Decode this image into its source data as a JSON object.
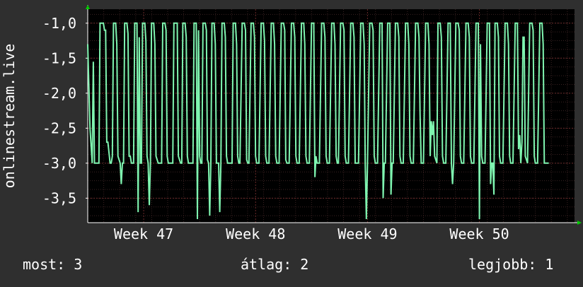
{
  "chart_data": {
    "type": "line",
    "ylabel": "onlinestream.live",
    "ylim": [
      -3.85,
      -0.8
    ],
    "yticks": [
      {
        "value": -1.0,
        "label": "-1,0"
      },
      {
        "value": -1.5,
        "label": "-1,5"
      },
      {
        "value": -2.0,
        "label": "-2,0"
      },
      {
        "value": -2.5,
        "label": "-2,5"
      },
      {
        "value": -3.0,
        "label": "-3,0"
      },
      {
        "value": -3.5,
        "label": "-3,5"
      }
    ],
    "xticks": [
      {
        "value": 1,
        "label": "Week 47"
      },
      {
        "value": 2,
        "label": "Week 48"
      },
      {
        "value": 3,
        "label": "Week 49"
      },
      {
        "value": 4,
        "label": "Week 50"
      }
    ],
    "xlim": [
      0.5,
      4.85
    ],
    "grid": true,
    "series": [
      {
        "color": "#7ff5b0",
        "points": [
          [
            0.5,
            -1.3
          ],
          [
            0.52,
            -2.5
          ],
          [
            0.54,
            -3.0
          ],
          [
            0.55,
            -1.55
          ],
          [
            0.56,
            -3.0
          ],
          [
            0.58,
            -3.0
          ],
          [
            0.6,
            -3.0
          ],
          [
            0.61,
            -1.0
          ],
          [
            0.63,
            -1.0
          ],
          [
            0.64,
            -1.0
          ],
          [
            0.65,
            -1.1
          ],
          [
            0.66,
            -1.1
          ],
          [
            0.67,
            -2.7
          ],
          [
            0.68,
            -2.7
          ],
          [
            0.7,
            -3.0
          ],
          [
            0.71,
            -3.0
          ],
          [
            0.72,
            -2.9
          ],
          [
            0.73,
            -1.0
          ],
          [
            0.75,
            -1.0
          ],
          [
            0.76,
            -1.3
          ],
          [
            0.77,
            -2.9
          ],
          [
            0.79,
            -3.0
          ],
          [
            0.8,
            -3.3
          ],
          [
            0.81,
            -3.0
          ],
          [
            0.82,
            -3.0
          ],
          [
            0.83,
            -1.0
          ],
          [
            0.85,
            -1.0
          ],
          [
            0.86,
            -1.15
          ],
          [
            0.87,
            -2.9
          ],
          [
            0.88,
            -2.9
          ],
          [
            0.89,
            -3.0
          ],
          [
            0.9,
            -3.0
          ],
          [
            0.91,
            -3.0
          ],
          [
            0.92,
            -1.0
          ],
          [
            0.94,
            -1.0
          ],
          [
            0.95,
            -3.7
          ],
          [
            0.96,
            -1.2
          ],
          [
            0.97,
            -3.0
          ],
          [
            0.98,
            -3.0
          ],
          [
            0.99,
            -1.0
          ],
          [
            1.01,
            -1.0
          ],
          [
            1.02,
            -1.25
          ],
          [
            1.03,
            -2.9
          ],
          [
            1.04,
            -3.0
          ],
          [
            1.05,
            -3.6
          ],
          [
            1.06,
            -3.0
          ],
          [
            1.07,
            -1.0
          ],
          [
            1.09,
            -1.0
          ],
          [
            1.1,
            -1.3
          ],
          [
            1.11,
            -2.9
          ],
          [
            1.12,
            -2.95
          ],
          [
            1.13,
            -3.0
          ],
          [
            1.15,
            -3.0
          ],
          [
            1.16,
            -3.0
          ],
          [
            1.17,
            -1.0
          ],
          [
            1.19,
            -1.0
          ],
          [
            1.2,
            -1.1
          ],
          [
            1.21,
            -2.9
          ],
          [
            1.22,
            -3.0
          ],
          [
            1.24,
            -3.0
          ],
          [
            1.26,
            -3.0
          ],
          [
            1.27,
            -1.0
          ],
          [
            1.29,
            -1.0
          ],
          [
            1.3,
            -1.0
          ],
          [
            1.31,
            -2.9
          ],
          [
            1.32,
            -2.95
          ],
          [
            1.33,
            -3.0
          ],
          [
            1.34,
            -3.0
          ],
          [
            1.35,
            -1.0
          ],
          [
            1.37,
            -1.0
          ],
          [
            1.38,
            -1.2
          ],
          [
            1.39,
            -2.9
          ],
          [
            1.4,
            -3.0
          ],
          [
            1.42,
            -3.0
          ],
          [
            1.44,
            -3.0
          ],
          [
            1.45,
            -1.0
          ],
          [
            1.47,
            -1.0
          ],
          [
            1.48,
            -3.8
          ],
          [
            1.49,
            -1.1
          ],
          [
            1.5,
            -2.9
          ],
          [
            1.51,
            -3.0
          ],
          [
            1.52,
            -3.0
          ],
          [
            1.53,
            -1.0
          ],
          [
            1.55,
            -1.0
          ],
          [
            1.56,
            -1.1
          ],
          [
            1.57,
            -2.95
          ],
          [
            1.58,
            -3.0
          ],
          [
            1.59,
            -3.75
          ],
          [
            1.6,
            -3.0
          ],
          [
            1.61,
            -1.0
          ],
          [
            1.63,
            -1.0
          ],
          [
            1.64,
            -1.3
          ],
          [
            1.65,
            -3.0
          ],
          [
            1.66,
            -3.0
          ],
          [
            1.67,
            -3.0
          ],
          [
            1.68,
            -3.7
          ],
          [
            1.69,
            -3.0
          ],
          [
            1.7,
            -1.0
          ],
          [
            1.72,
            -1.0
          ],
          [
            1.73,
            -1.2
          ],
          [
            1.74,
            -2.9
          ],
          [
            1.75,
            -3.0
          ],
          [
            1.77,
            -3.0
          ],
          [
            1.79,
            -3.0
          ],
          [
            1.8,
            -1.0
          ],
          [
            1.82,
            -1.0
          ],
          [
            1.83,
            -1.3
          ],
          [
            1.84,
            -2.9
          ],
          [
            1.85,
            -3.0
          ],
          [
            1.86,
            -3.0
          ],
          [
            1.88,
            -1.0
          ],
          [
            1.9,
            -1.0
          ],
          [
            1.91,
            -1.1
          ],
          [
            1.92,
            -2.95
          ],
          [
            1.93,
            -3.0
          ],
          [
            1.94,
            -3.0
          ],
          [
            1.96,
            -1.0
          ],
          [
            1.98,
            -1.0
          ],
          [
            1.99,
            -1.2
          ],
          [
            2.0,
            -2.9
          ],
          [
            2.01,
            -3.0
          ],
          [
            2.03,
            -3.0
          ],
          [
            2.05,
            -1.0
          ],
          [
            2.07,
            -1.0
          ],
          [
            2.08,
            -1.25
          ],
          [
            2.09,
            -2.9
          ],
          [
            2.1,
            -3.0
          ],
          [
            2.12,
            -3.0
          ],
          [
            2.14,
            -1.0
          ],
          [
            2.16,
            -1.0
          ],
          [
            2.17,
            -1.3
          ],
          [
            2.18,
            -2.9
          ],
          [
            2.19,
            -3.0
          ],
          [
            2.21,
            -3.0
          ],
          [
            2.23,
            -1.0
          ],
          [
            2.25,
            -1.0
          ],
          [
            2.26,
            -1.1
          ],
          [
            2.27,
            -2.95
          ],
          [
            2.28,
            -3.0
          ],
          [
            2.3,
            -3.0
          ],
          [
            2.32,
            -1.0
          ],
          [
            2.34,
            -1.0
          ],
          [
            2.35,
            -1.2
          ],
          [
            2.36,
            -2.9
          ],
          [
            2.37,
            -3.0
          ],
          [
            2.39,
            -3.0
          ],
          [
            2.41,
            -1.0
          ],
          [
            2.43,
            -1.0
          ],
          [
            2.44,
            -1.3
          ],
          [
            2.45,
            -2.9
          ],
          [
            2.46,
            -3.0
          ],
          [
            2.48,
            -3.0
          ],
          [
            2.5,
            -1.0
          ],
          [
            2.52,
            -1.0
          ],
          [
            2.53,
            -3.2
          ],
          [
            2.54,
            -2.9
          ],
          [
            2.55,
            -3.0
          ],
          [
            2.57,
            -3.0
          ],
          [
            2.59,
            -1.0
          ],
          [
            2.61,
            -1.0
          ],
          [
            2.62,
            -1.2
          ],
          [
            2.63,
            -2.9
          ],
          [
            2.64,
            -3.0
          ],
          [
            2.66,
            -3.0
          ],
          [
            2.68,
            -1.0
          ],
          [
            2.7,
            -1.0
          ],
          [
            2.71,
            -1.3
          ],
          [
            2.72,
            -2.9
          ],
          [
            2.73,
            -3.0
          ],
          [
            2.74,
            -3.0
          ],
          [
            2.76,
            -1.0
          ],
          [
            2.78,
            -1.0
          ],
          [
            2.79,
            -1.1
          ],
          [
            2.8,
            -2.9
          ],
          [
            2.81,
            -3.0
          ],
          [
            2.83,
            -3.0
          ],
          [
            2.85,
            -1.0
          ],
          [
            2.87,
            -1.0
          ],
          [
            2.88,
            -1.2
          ],
          [
            2.89,
            -3.0
          ],
          [
            2.9,
            -3.0
          ],
          [
            2.92,
            -3.0
          ],
          [
            2.94,
            -1.0
          ],
          [
            2.96,
            -1.0
          ],
          [
            2.97,
            -1.3
          ],
          [
            2.98,
            -3.0
          ],
          [
            2.99,
            -3.8
          ],
          [
            3.0,
            -3.0
          ],
          [
            3.02,
            -1.0
          ],
          [
            3.04,
            -1.0
          ],
          [
            3.05,
            -1.1
          ],
          [
            3.06,
            -2.9
          ],
          [
            3.07,
            -3.0
          ],
          [
            3.09,
            -3.0
          ],
          [
            3.11,
            -1.0
          ],
          [
            3.13,
            -1.0
          ],
          [
            3.14,
            -3.5
          ],
          [
            3.15,
            -3.0
          ],
          [
            3.16,
            -3.0
          ],
          [
            3.18,
            -1.0
          ],
          [
            3.2,
            -1.0
          ],
          [
            3.21,
            -3.45
          ],
          [
            3.22,
            -3.0
          ],
          [
            3.23,
            -3.0
          ],
          [
            3.25,
            -1.0
          ],
          [
            3.27,
            -1.0
          ],
          [
            3.28,
            -1.2
          ],
          [
            3.29,
            -2.9
          ],
          [
            3.3,
            -3.0
          ],
          [
            3.32,
            -3.0
          ],
          [
            3.34,
            -1.0
          ],
          [
            3.36,
            -1.0
          ],
          [
            3.37,
            -1.3
          ],
          [
            3.38,
            -2.9
          ],
          [
            3.39,
            -3.0
          ],
          [
            3.41,
            -3.0
          ],
          [
            3.43,
            -1.0
          ],
          [
            3.45,
            -1.0
          ],
          [
            3.46,
            -1.2
          ],
          [
            3.47,
            -2.3
          ],
          [
            3.48,
            -3.0
          ],
          [
            3.5,
            -3.0
          ],
          [
            3.52,
            -1.0
          ],
          [
            3.54,
            -1.0
          ],
          [
            3.55,
            -1.3
          ],
          [
            3.56,
            -2.9
          ],
          [
            3.57,
            -2.4
          ],
          [
            3.58,
            -2.6
          ],
          [
            3.59,
            -2.4
          ],
          [
            3.6,
            -2.9
          ],
          [
            3.62,
            -3.0
          ],
          [
            3.63,
            -1.0
          ],
          [
            3.65,
            -1.0
          ],
          [
            3.66,
            -1.2
          ],
          [
            3.67,
            -2.9
          ],
          [
            3.68,
            -3.0
          ],
          [
            3.7,
            -3.0
          ],
          [
            3.72,
            -1.0
          ],
          [
            3.74,
            -1.0
          ],
          [
            3.75,
            -3.0
          ],
          [
            3.76,
            -3.3
          ],
          [
            3.77,
            -3.0
          ],
          [
            3.79,
            -1.0
          ],
          [
            3.81,
            -1.0
          ],
          [
            3.82,
            -1.1
          ],
          [
            3.83,
            -2.9
          ],
          [
            3.84,
            -3.0
          ],
          [
            3.86,
            -3.0
          ],
          [
            3.88,
            -1.0
          ],
          [
            3.9,
            -1.0
          ],
          [
            3.91,
            -1.2
          ],
          [
            3.92,
            -2.9
          ],
          [
            3.93,
            -3.0
          ],
          [
            3.95,
            -3.0
          ],
          [
            3.97,
            -1.0
          ],
          [
            3.99,
            -1.0
          ],
          [
            4.0,
            -3.8
          ],
          [
            4.01,
            -1.3
          ],
          [
            4.02,
            -2.9
          ],
          [
            4.03,
            -3.0
          ],
          [
            4.05,
            -3.0
          ],
          [
            4.07,
            -1.0
          ],
          [
            4.09,
            -1.0
          ],
          [
            4.1,
            -3.3
          ],
          [
            4.11,
            -3.0
          ],
          [
            4.12,
            -3.0
          ],
          [
            4.13,
            -3.45
          ],
          [
            4.14,
            -1.0
          ],
          [
            4.16,
            -1.0
          ],
          [
            4.17,
            -1.2
          ],
          [
            4.18,
            -2.9
          ],
          [
            4.19,
            -3.0
          ],
          [
            4.21,
            -3.0
          ],
          [
            4.23,
            -1.0
          ],
          [
            4.25,
            -1.0
          ],
          [
            4.26,
            -1.3
          ],
          [
            4.27,
            -2.9
          ],
          [
            4.28,
            -3.0
          ],
          [
            4.3,
            -3.0
          ],
          [
            4.32,
            -1.0
          ],
          [
            4.34,
            -1.0
          ],
          [
            4.35,
            -2.8
          ],
          [
            4.36,
            -2.6
          ],
          [
            4.37,
            -3.0
          ],
          [
            4.38,
            -2.7
          ],
          [
            4.39,
            -1.2
          ],
          [
            4.4,
            -1.2
          ],
          [
            4.41,
            -2.9
          ],
          [
            4.43,
            -3.0
          ],
          [
            4.45,
            -1.0
          ],
          [
            4.47,
            -1.0
          ],
          [
            4.48,
            -1.1
          ],
          [
            4.49,
            -2.9
          ],
          [
            4.5,
            -3.0
          ],
          [
            4.52,
            -3.0
          ],
          [
            4.54,
            -1.0
          ],
          [
            4.56,
            -1.0
          ],
          [
            4.57,
            -1.3
          ],
          [
            4.58,
            -3.0
          ],
          [
            4.6,
            -3.0
          ],
          [
            4.62,
            -3.0
          ]
        ]
      }
    ]
  },
  "footer": {
    "current": "most: 3",
    "average": "átlag: 2",
    "best": "legjobb: 1"
  }
}
